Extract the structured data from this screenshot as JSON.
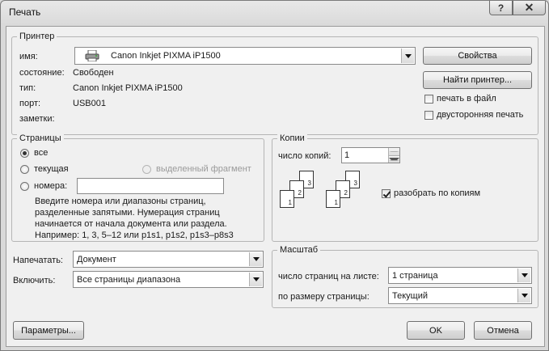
{
  "window": {
    "title": "Печать",
    "help": "?",
    "close": "✕"
  },
  "printer": {
    "legend": "Принтер",
    "name_label": "имя:",
    "name_value": "Canon Inkjet PIXMA iP1500",
    "status_label": "состояние:",
    "status_value": "Свободен",
    "type_label": "тип:",
    "type_value": "Canon Inkjet PIXMA iP1500",
    "port_label": "порт:",
    "port_value": "USB001",
    "notes_label": "заметки:",
    "properties_button": "Свойства",
    "find_printer_button": "Найти принтер...",
    "print_to_file": {
      "label": "печать в файл",
      "checked": false
    },
    "duplex": {
      "label": "двусторонняя печать",
      "checked": false
    }
  },
  "pages": {
    "legend": "Страницы",
    "all": "все",
    "current": "текущая",
    "selection": "выделенный фрагмент",
    "numbers": "номера:",
    "numbers_value": "",
    "selected": "all",
    "hint": [
      "Введите номера или диапазоны страниц,",
      "разделенные запятыми. Нумерация страниц",
      "начинается от начала документа или раздела.",
      "Например: 1, 3, 5–12 или p1s1, p1s2, p1s3–p8s3"
    ]
  },
  "print_what": {
    "label": "Напечатать:",
    "value": "Документ"
  },
  "include": {
    "label": "Включить:",
    "value": "Все страницы диапазона"
  },
  "copies": {
    "legend": "Копии",
    "count_label": "число копий:",
    "count_value": "1",
    "collate": {
      "label": "разобрать по копиям",
      "checked": true
    },
    "page_numbers": [
      "1",
      "2",
      "3"
    ]
  },
  "zoom": {
    "legend": "Масштаб",
    "pages_per_sheet_label": "число страниц на листе:",
    "pages_per_sheet_value": "1 страница",
    "scale_label": "по размеру страницы:",
    "scale_value": "Текущий"
  },
  "buttons": {
    "options": "Параметры...",
    "ok": "OK",
    "cancel": "Отмена"
  }
}
